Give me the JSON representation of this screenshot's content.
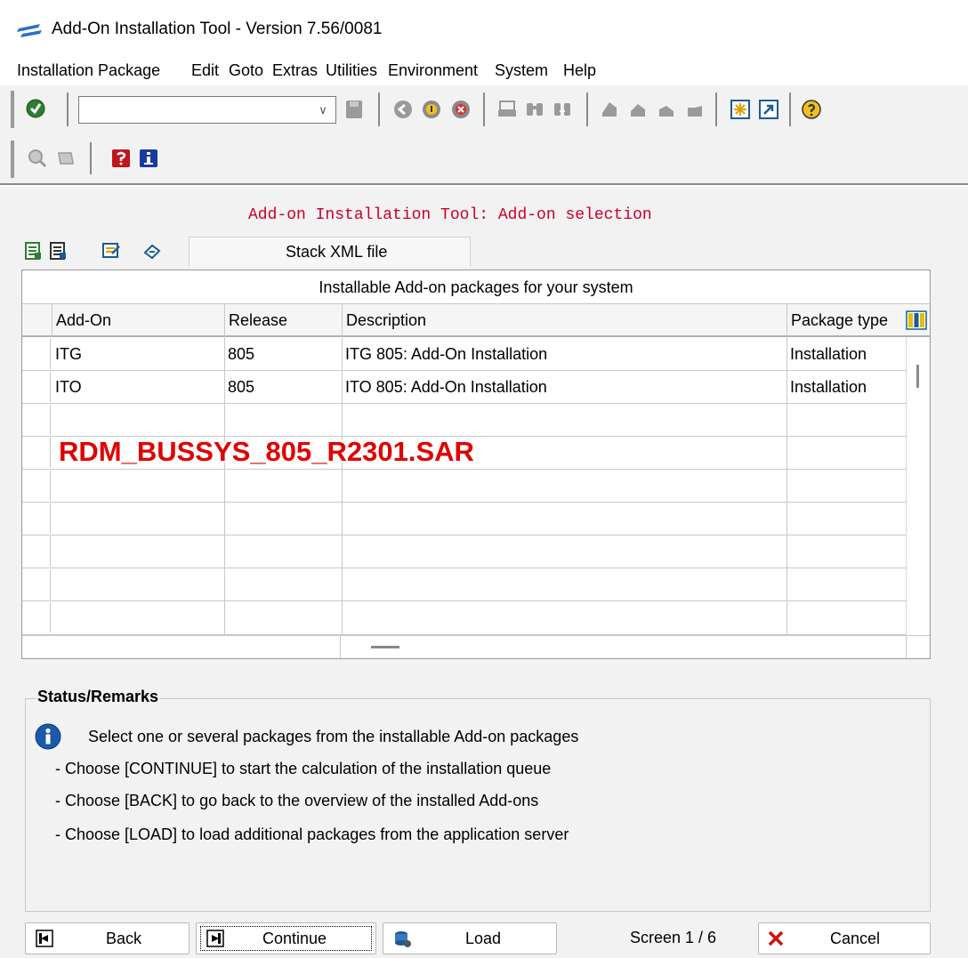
{
  "window": {
    "title": "Add-On Installation Tool - Version 7.56/0081",
    "app_icon": "sap-logo-icon"
  },
  "menu": [
    "Installation Package",
    "Edit",
    "Goto",
    "Extras",
    "Utilities",
    "Environment",
    "System",
    "Help"
  ],
  "toolbar": {
    "command_field_value": "",
    "icons": [
      "enter-icon",
      "save-icon",
      "back-icon",
      "exit-icon",
      "cancel-icon",
      "print-icon",
      "find-icon",
      "find-next-icon",
      "first-page-icon",
      "previous-page-icon",
      "next-page-icon",
      "last-page-icon",
      "new-session-icon",
      "shortcut-icon",
      "help-icon"
    ],
    "app_icons": [
      "display-log-icon",
      "display-details-icon",
      "help-book-icon",
      "info-icon"
    ]
  },
  "screen": {
    "heading": "Add-on Installation Tool: Add-on selection",
    "stack_button_label": "Stack XML file",
    "table_icons": [
      "select-all-icon",
      "deselect-all-icon",
      "filter-icon",
      "refresh-icon",
      "load-icon"
    ]
  },
  "table": {
    "title": "Installable Add-on packages for your system",
    "columns": [
      "Add-On",
      "Release",
      "Description",
      "Package type"
    ],
    "rows": [
      {
        "addon": "ITG",
        "release": "805",
        "description": "ITG 805: Add-On Installation",
        "package_type": "Installation"
      },
      {
        "addon": "ITO",
        "release": "805",
        "description": "ITO 805: Add-On Installation",
        "package_type": "Installation"
      }
    ],
    "empty_rows": 7
  },
  "annotation": "RDM_BUSSYS_805_R2301.SAR",
  "status": {
    "title": "Status/Remarks",
    "lines": [
      "Select one or several packages from the installable Add-on packages",
      "- Choose [CONTINUE] to start the calculation of the installation queue",
      "- Choose [BACK] to go back to the overview of the installed Add-ons",
      "- Choose [LOAD] to load additional packages from the application server"
    ]
  },
  "footer": {
    "back_label": "Back",
    "continue_label": "Continue",
    "load_label": "Load",
    "screen_indicator": "Screen 1 / 6",
    "cancel_label": "Cancel"
  }
}
